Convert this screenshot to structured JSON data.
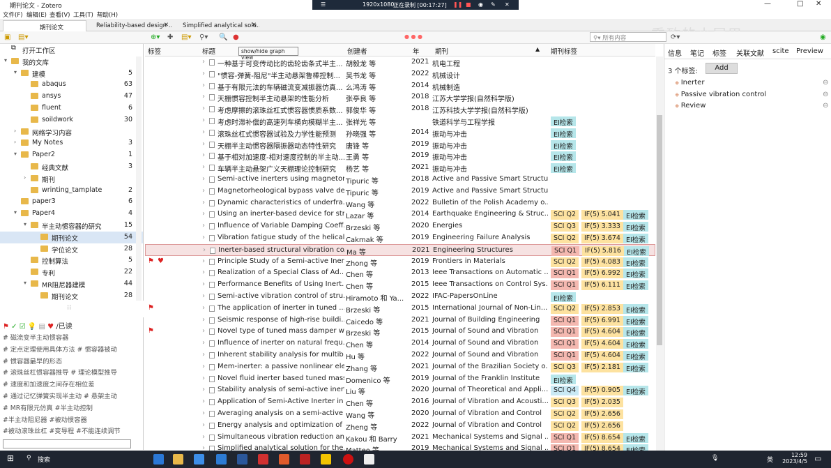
{
  "window": {
    "title": "期刊论文 - Zotero",
    "minimize": "—",
    "maximize": "□",
    "close": "✕"
  },
  "recorder": {
    "resolution": "1920x1080",
    "status": "正在录制 [00:17:27]"
  },
  "menu": [
    "文件(F)",
    "编辑(E)",
    "查看(V)",
    "工具(T)",
    "帮助(H)"
  ],
  "tabs": [
    {
      "label": "期刊论文",
      "active": true
    },
    {
      "label": "Reliability-based design ..."
    },
    {
      "label": "Simplified analytical solu..."
    }
  ],
  "toolbar": {
    "search_placeholder": "所有内容",
    "tooltip": "show/hide graph view"
  },
  "watermark": "重致的小尾巴",
  "collections": [
    {
      "label": "打开工作区",
      "level": 0,
      "arrow": "",
      "count": ""
    },
    {
      "label": "我的文库",
      "level": 0,
      "arrow": "▾",
      "count": ""
    },
    {
      "label": "建模",
      "level": 1,
      "arrow": "▾",
      "count": "5"
    },
    {
      "label": "abaqus",
      "level": 2,
      "arrow": "",
      "count": "63"
    },
    {
      "label": "ansys",
      "level": 2,
      "arrow": "",
      "count": "47"
    },
    {
      "label": "fluent",
      "level": 2,
      "arrow": "",
      "count": "6"
    },
    {
      "label": "soildwork",
      "level": 2,
      "arrow": "",
      "count": "30"
    },
    {
      "label": "网络学习内容",
      "level": 1,
      "arrow": "›",
      "count": ""
    },
    {
      "label": "My Notes",
      "level": 1,
      "arrow": "›",
      "count": "3"
    },
    {
      "label": "Paper2",
      "level": 1,
      "arrow": "▾",
      "count": "1"
    },
    {
      "label": "经典文献",
      "level": 2,
      "arrow": "",
      "count": "3"
    },
    {
      "label": "期刊",
      "level": 2,
      "arrow": "›",
      "count": ""
    },
    {
      "label": "wrinting_tamplate",
      "level": 2,
      "arrow": "",
      "count": "2"
    },
    {
      "label": "paper3",
      "level": 1,
      "arrow": "",
      "count": "6"
    },
    {
      "label": "Paper4",
      "level": 1,
      "arrow": "▾",
      "count": "4"
    },
    {
      "label": "半主动惯容器的研究",
      "level": 2,
      "arrow": "▾",
      "count": "15"
    },
    {
      "label": "期刊论文",
      "level": 3,
      "arrow": "",
      "count": "54",
      "sel": true
    },
    {
      "label": "学位论文",
      "level": 3,
      "arrow": "",
      "count": "28"
    },
    {
      "label": "控制算法",
      "level": 2,
      "arrow": "",
      "count": "5"
    },
    {
      "label": "专利",
      "level": 2,
      "arrow": "",
      "count": "22"
    },
    {
      "label": "MR阻尼器建模",
      "level": 2,
      "arrow": "▾",
      "count": "44"
    },
    {
      "label": "期刊论文",
      "level": 3,
      "arrow": "",
      "count": "28"
    }
  ],
  "tag_selector": {
    "read_label": "/已读",
    "lines": [
      "# 磁流变半主动惯容器",
      "# 定点定理使用具体方法  # 惯容器被动",
      "# 惯容器最早的形态",
      "# 滚珠丝杠惯容器推导  # 理论模型推导",
      "# 速度和加速度之间存在相位差",
      "# 通过记忆弹簧实现半主动  # 悬架主动",
      "# MR有限元仿真  #半主动控制",
      "#半主动阻尼器  #被动惯容器",
      "#被动滚珠丝杠  #变导程  #不能连续调节"
    ]
  },
  "columns": {
    "tags": "标签",
    "title": "标题",
    "creator": "创建者",
    "year": "年",
    "journal": "期刊",
    "jtags": "期刊标签"
  },
  "rows": [
    {
      "title": "一种基于可变传动比的齿轮齿条式半主...",
      "creator": "胡毅龙 等",
      "year": "2021",
      "journal": "机电工程",
      "b": []
    },
    {
      "title": "\"惯容-弹簧-阻尼\"半主动悬架鲁棒控制...",
      "creator": "吴书龙 等",
      "year": "2022",
      "journal": "机械设计",
      "b": []
    },
    {
      "title": "基于有限元法的车辆磁流变减振器仿真...",
      "creator": "么鸿涛 等",
      "year": "2014",
      "journal": "机械制造",
      "b": []
    },
    {
      "title": "天棚惯容控制半主动悬架的性能分析",
      "creator": "张亭良 等",
      "year": "2018",
      "journal": "江苏大学学报(自然科学版)",
      "b": []
    },
    {
      "title": "考虑摩擦的滚珠丝杠式惯容器惯质系数...",
      "creator": "郭俊华 等",
      "year": "2018",
      "journal": "江苏科技大学学报(自然科学版)",
      "b": []
    },
    {
      "title": "考虑时滞补偿的高速列车横向模糊半主...",
      "creator": "张祥光 等",
      "year": "",
      "journal": "铁道科学与工程学报",
      "b": [
        {
          "c": "ei",
          "t": "EI检索"
        }
      ]
    },
    {
      "title": "滚珠丝杠式惯容器试验及力学性能预测",
      "creator": "孙晓强 等",
      "year": "2014",
      "journal": "振动与冲击",
      "b": [
        {
          "c": "ei",
          "t": "EI检索"
        }
      ]
    },
    {
      "title": "天棚半主动惯容器隔振器动态特性研究",
      "creator": "唐锋 等",
      "year": "2019",
      "journal": "振动与冲击",
      "b": [
        {
          "c": "ei",
          "t": "EI检索"
        }
      ]
    },
    {
      "title": "基于相对加速度-相对速度控制的半主动...",
      "creator": "王勇 等",
      "year": "2019",
      "journal": "振动与冲击",
      "b": [
        {
          "c": "ei",
          "t": "EI检索"
        }
      ]
    },
    {
      "title": "车辆半主动悬架广义天棚理论控制研究",
      "creator": "杨艺 等",
      "year": "2021",
      "journal": "振动与冲击",
      "b": [
        {
          "c": "ei",
          "t": "EI检索"
        }
      ]
    },
    {
      "title": "Semi-active inerters using magnetor...",
      "creator": "Tipuric 等",
      "year": "2018",
      "journal": "Active and Passive Smart Structu...",
      "b": []
    },
    {
      "title": "Magnetorheological bypass valve de...",
      "creator": "Tipuric 等",
      "year": "2019",
      "journal": "Active and Passive Smart Structu...",
      "b": []
    },
    {
      "title": "Dynamic characteristics of underfra...",
      "creator": "Wang 等",
      "year": "2022",
      "journal": "Bulletin of the Polish Academy o...",
      "b": []
    },
    {
      "title": "Using an inerter-based device for str...",
      "creator": "Lazar 等",
      "year": "2014",
      "journal": "Earthquake Engineering & Struc...",
      "b": [
        {
          "c": "q2",
          "t": "SCI Q2"
        },
        {
          "c": "if",
          "t": "IF(5) 5.041"
        },
        {
          "c": "ei",
          "t": "EI检索"
        }
      ]
    },
    {
      "title": "Influence of Variable Damping Coeff...",
      "creator": "Brzeski 等",
      "year": "2020",
      "journal": "Energies",
      "b": [
        {
          "c": "q3",
          "t": "SCI Q3"
        },
        {
          "c": "if",
          "t": "IF(5) 3.333"
        },
        {
          "c": "ei",
          "t": "EI检索"
        }
      ]
    },
    {
      "title": "Vibration fatigue study of the helical...",
      "creator": "Cakmak 等",
      "year": "2019",
      "journal": "Engineering Failure Analysis",
      "b": [
        {
          "c": "q2",
          "t": "SCI Q2"
        },
        {
          "c": "if",
          "t": "IF(5) 3.674"
        },
        {
          "c": "ei",
          "t": "EI检索"
        }
      ]
    },
    {
      "title": "Inerter-based structural vibration co...",
      "creator": "Ma 等",
      "year": "2021",
      "journal": "Engineering Structures",
      "sel": true,
      "b": [
        {
          "c": "q1",
          "t": "SCI Q1"
        },
        {
          "c": "if",
          "t": "IF(5) 5.816"
        },
        {
          "c": "ei",
          "t": "EI检索"
        }
      ]
    },
    {
      "title": "Principle Study of a Semi-active Iner...",
      "creator": "Zhong 等",
      "year": "2019",
      "journal": "Frontiers in Materials",
      "flag": "both",
      "b": [
        {
          "c": "q2",
          "t": "SCI Q2"
        },
        {
          "c": "if",
          "t": "IF(5) 4.083"
        },
        {
          "c": "ei",
          "t": "EI检索"
        }
      ]
    },
    {
      "title": "Realization of a Special Class of Ad...",
      "creator": "Chen 等",
      "year": "2013",
      "journal": "Ieee Transactions on Automatic ...",
      "b": [
        {
          "c": "q1",
          "t": "SCI Q1"
        },
        {
          "c": "if",
          "t": "IF(5) 6.992"
        },
        {
          "c": "ei",
          "t": "EI检索"
        }
      ]
    },
    {
      "title": "Performance Benefits of Using Inert...",
      "creator": "Chen 等",
      "year": "2015",
      "journal": "Ieee Transactions on Control Sys...",
      "b": [
        {
          "c": "q1",
          "t": "SCI Q1"
        },
        {
          "c": "if",
          "t": "IF(5) 6.111"
        },
        {
          "c": "ei",
          "t": "EI检索"
        }
      ]
    },
    {
      "title": "Semi-active vibration control of stru...",
      "creator": "Hiramoto 和 Ya...",
      "year": "2022",
      "journal": "IFAC-PapersOnLine",
      "b": [
        {
          "c": "ei",
          "t": "EI检索"
        }
      ]
    },
    {
      "title": "The application of inerter in tuned ...",
      "creator": "Brzeski 等",
      "year": "2015",
      "journal": "International Journal of Non-Lin...",
      "flag": "flag",
      "b": [
        {
          "c": "q2",
          "t": "SCI Q2"
        },
        {
          "c": "if",
          "t": "IF(5) 2.853"
        },
        {
          "c": "ei",
          "t": "EI检索"
        }
      ]
    },
    {
      "title": "Seismic response of high-rise buildi...",
      "creator": "Caicedo 等",
      "year": "2021",
      "journal": "Journal of Building Engineering",
      "b": [
        {
          "c": "q1",
          "t": "SCI Q1"
        },
        {
          "c": "if",
          "t": "IF(5) 6.991"
        },
        {
          "c": "ei",
          "t": "EI检索"
        }
      ]
    },
    {
      "title": "Novel type of tuned mass damper w...",
      "creator": "Brzeski 等",
      "year": "2015",
      "journal": "Journal of Sound and Vibration",
      "flag": "flag",
      "b": [
        {
          "c": "q1",
          "t": "SCI Q1"
        },
        {
          "c": "if",
          "t": "IF(5) 4.604"
        },
        {
          "c": "ei",
          "t": "EI检索"
        }
      ]
    },
    {
      "title": "Influence of inerter on natural frequ...",
      "creator": "Chen 等",
      "year": "2014",
      "journal": "Journal of Sound and Vibration",
      "b": [
        {
          "c": "q1",
          "t": "SCI Q1"
        },
        {
          "c": "if",
          "t": "IF(5) 4.604"
        },
        {
          "c": "ei",
          "t": "EI检索"
        }
      ]
    },
    {
      "title": "Inherent stability analysis for multib...",
      "creator": "Hu 等",
      "year": "2022",
      "journal": "Journal of Sound and Vibration",
      "b": [
        {
          "c": "q1",
          "t": "SCI Q1"
        },
        {
          "c": "if",
          "t": "IF(5) 4.604"
        },
        {
          "c": "ei",
          "t": "EI检索"
        }
      ]
    },
    {
      "title": "Mem-inerter: a passive nonlinear ele...",
      "creator": "Zhang 等",
      "year": "2021",
      "journal": "Journal of the Brazilian Society o...",
      "b": [
        {
          "c": "q3",
          "t": "SCI Q3"
        },
        {
          "c": "if",
          "t": "IF(5) 2.181"
        },
        {
          "c": "ei",
          "t": "EI检索"
        }
      ]
    },
    {
      "title": "Novel fluid inerter based tuned mass...",
      "creator": "Domenico 等",
      "year": "2019",
      "journal": "Journal of the Franklin Institute",
      "b": [
        {
          "c": "ei",
          "t": "EI检索"
        }
      ]
    },
    {
      "title": "Stability analysis of semi-active inert...",
      "creator": "Liu 等",
      "year": "2020",
      "journal": "Journal of Theoretical and Appli...",
      "b": [
        {
          "c": "q4",
          "t": "SCI Q4"
        },
        {
          "c": "if",
          "t": "IF(5) 0.905"
        },
        {
          "c": "ei",
          "t": "EI检索"
        }
      ]
    },
    {
      "title": "Application of Semi-Active Inerter in ...",
      "creator": "Chen 等",
      "year": "2016",
      "journal": "Journal of Vibration and Acousti...",
      "b": [
        {
          "c": "q3",
          "t": "SCI Q3"
        },
        {
          "c": "if",
          "t": "IF(5) 2.035"
        }
      ]
    },
    {
      "title": "Averaging analysis on a semi-active ...",
      "creator": "Wang 等",
      "year": "2020",
      "journal": "Journal of Vibration and Control",
      "b": [
        {
          "c": "q2",
          "t": "SCI Q2"
        },
        {
          "c": "if",
          "t": "IF(5) 2.656"
        }
      ]
    },
    {
      "title": "Energy analysis and optimization of ...",
      "creator": "Zheng 等",
      "year": "2022",
      "journal": "Journal of Vibration and Control",
      "b": [
        {
          "c": "q2",
          "t": "SCI Q2"
        },
        {
          "c": "if",
          "t": "IF(5) 2.656"
        }
      ]
    },
    {
      "title": "Simultaneous vibration reduction an...",
      "creator": "Kakou 和 Barry",
      "year": "2021",
      "journal": "Mechanical Systems and Signal ...",
      "b": [
        {
          "c": "q1",
          "t": "SCI Q1"
        },
        {
          "c": "if",
          "t": "IF(5) 8.654"
        },
        {
          "c": "ei",
          "t": "EI检索"
        }
      ]
    },
    {
      "title": "Simplified analytical solution for the...",
      "creator": "Matteo 等",
      "year": "2019",
      "journal": "Mechanical Systems and Signal ...",
      "b": [
        {
          "c": "q1",
          "t": "SCI Q1"
        },
        {
          "c": "if",
          "t": "IF(5) 8.654"
        },
        {
          "c": "ei",
          "t": "EI检索"
        }
      ]
    }
  ],
  "right": {
    "tabs": [
      "信息",
      "笔记",
      "标签",
      "关联文献",
      "scite",
      "Preview"
    ],
    "tag_count": "3 个标签:",
    "add": "Add",
    "tags": [
      "Inerter",
      "Passive vibration control",
      "Review"
    ]
  },
  "taskbar": {
    "search": "搜索",
    "ime": "英",
    "time": "12:59",
    "date": "2023/4/5"
  }
}
